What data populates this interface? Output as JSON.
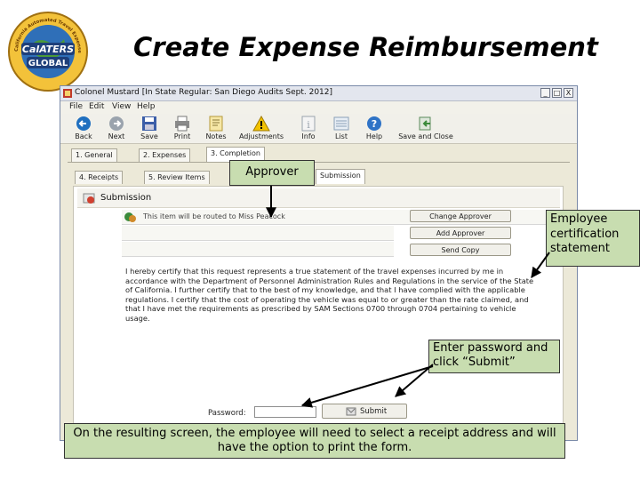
{
  "slide": {
    "title": "Create Expense Reimbursement",
    "logo": {
      "top_text": "California Automated Travel Expense Reimbursement System",
      "center_text": "CalATERS",
      "lower_text": "GLOBAL"
    }
  },
  "window": {
    "title": "Colonel Mustard [In State Regular: San Diego Audits Sept. 2012]",
    "controls": [
      "_",
      "□",
      "X"
    ],
    "menu": [
      "File",
      "Edit",
      "View",
      "Help"
    ]
  },
  "toolbar": [
    {
      "label": "Back",
      "icon": "back-arrow-icon",
      "color": "#1f6fbf"
    },
    {
      "label": "Next",
      "icon": "next-arrow-icon",
      "color": "#9aa3ad"
    },
    {
      "label": "Save",
      "icon": "floppy-disk-icon",
      "color": "#3b5ea8"
    },
    {
      "label": "Print",
      "icon": "printer-icon",
      "color": "#7a7a7a"
    },
    {
      "label": "Notes",
      "icon": "notes-icon",
      "color": "#d9b64a"
    },
    {
      "label": "Adjustments",
      "icon": "warning-icon",
      "color": "#e0b000"
    },
    {
      "label": "Info",
      "icon": "info-icon",
      "color": "#9aa3ad"
    },
    {
      "label": "List",
      "icon": "list-icon",
      "color": "#8aa0b8"
    },
    {
      "label": "Help",
      "icon": "help-icon",
      "color": "#2f73c6"
    },
    {
      "label": "Save and Close",
      "icon": "save-close-icon",
      "color": "#3a8a3a"
    }
  ],
  "tabs_main": [
    "1. General",
    "2. Expenses",
    "3. Completion"
  ],
  "tabs_sub": [
    "4. Receipts",
    "5. Review Items",
    "Submission"
  ],
  "panel": {
    "header": "Submission",
    "notice": "This item will be routed to Miss Peacock",
    "buttons": [
      "Change Approver",
      "Add Approver",
      "Send Copy"
    ]
  },
  "certification": "I hereby certify that this request represents a true statement of the travel expenses incurred by me in accordance with the Department of Personnel Administration Rules and Regulations in the service of the State of California. I further certify that to the best of my knowledge, and that I have complied with the applicable regulations. I certify that the cost of operating the vehicle was equal to or greater than the rate claimed, and that I have met the requirements as prescribed by SAM Sections 0700 through 0704 pertaining to vehicle usage.",
  "password": {
    "label": "Password:",
    "value": ""
  },
  "submit_label": "Submit",
  "callouts": {
    "approver": "Approver",
    "employee_cert": "Employee certification statement",
    "enter_password": "Enter password and click “Submit”",
    "bottom": "On the resulting screen, the employee will need to select a receipt address and will have the option to print the form."
  },
  "colors": {
    "callout_bg": "#c8ddb0",
    "window_bg": "#ece9d8"
  }
}
